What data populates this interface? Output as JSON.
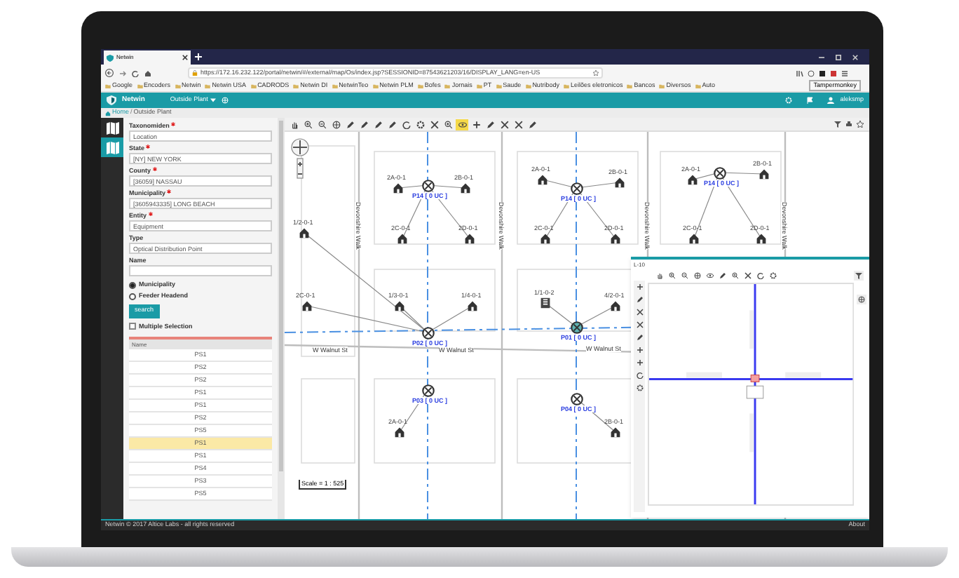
{
  "browser": {
    "tab_title": "Netwin",
    "url": "https://172.16.232.122/portal/netwin/#/external/map/Os/index.jsp?SESSIONID=87543621203/16/DISPLAY_LANG=en-US",
    "tooltip": "Tampermonkey",
    "bookmarks": [
      "Google",
      "Encoders",
      "Netwin",
      "Netwin USA",
      "CADRODS",
      "Netwin DI",
      "NetwinTeo",
      "Netwin PLM",
      "Bofes",
      "Jornais",
      "PT",
      "Saude",
      "Nutribody",
      "Leilões eletronicos",
      "Bancos",
      "Diversos",
      "Auto"
    ]
  },
  "app": {
    "brand": "Netwin",
    "module": "Outside Plant",
    "user": "aleksmp",
    "breadcrumb": [
      "Home",
      "/",
      "Outside Plant"
    ]
  },
  "rail": [
    {
      "selected": false
    },
    {
      "selected": true
    }
  ],
  "form": {
    "fields": [
      {
        "label": "Taxonomiden",
        "required": true,
        "value": "Location"
      },
      {
        "label": "State",
        "required": true,
        "value": "[NY] NEW YORK"
      },
      {
        "label": "County",
        "required": true,
        "value": "[36059] NASSAU"
      },
      {
        "label": "Municipality",
        "required": true,
        "value": "[3605943335] LONG BEACH"
      },
      {
        "label": "Entity",
        "required": true,
        "value": "Equipment"
      },
      {
        "label": "Type",
        "required": false,
        "value": "Optical Distribution Point"
      },
      {
        "label": "Name",
        "required": false
      }
    ],
    "radios": [
      {
        "label": "Municipality",
        "selected": true
      },
      {
        "label": "Feeder Headend",
        "selected": false
      }
    ],
    "search_button": "search",
    "multiple_selection": {
      "label": "Multiple Selection",
      "checked": false
    }
  },
  "results": {
    "column": "Name",
    "rows": [
      {
        "name": "PS1",
        "selected": false
      },
      {
        "name": "PS2",
        "selected": false
      },
      {
        "name": "PS2",
        "selected": false
      },
      {
        "name": "PS1",
        "selected": false
      },
      {
        "name": "PS1",
        "selected": false
      },
      {
        "name": "PS2",
        "selected": false
      },
      {
        "name": "PS5",
        "selected": false
      },
      {
        "name": "PS1",
        "selected": true
      },
      {
        "name": "PS1",
        "selected": false
      },
      {
        "name": "PS4",
        "selected": false
      },
      {
        "name": "PS3",
        "selected": false
      },
      {
        "name": "PS5",
        "selected": false
      }
    ]
  },
  "map": {
    "tools": [
      {
        "kind": "hand",
        "selected": false
      },
      {
        "kind": "zoomin",
        "selected": false
      },
      {
        "kind": "zoomout",
        "selected": false
      },
      {
        "kind": "globe",
        "selected": false
      },
      {
        "kind": "pencil",
        "selected": false
      },
      {
        "kind": "pencil",
        "selected": false
      },
      {
        "kind": "pencil",
        "selected": false
      },
      {
        "kind": "pencil",
        "selected": false
      },
      {
        "kind": "refresh",
        "selected": false
      },
      {
        "kind": "gear",
        "selected": false
      },
      {
        "kind": "cross",
        "selected": false
      },
      {
        "kind": "zoomin",
        "selected": false
      },
      {
        "kind": "eye",
        "selected": true
      },
      {
        "kind": "plus",
        "selected": false
      },
      {
        "kind": "pencil",
        "selected": false
      },
      {
        "kind": "cross",
        "selected": false
      },
      {
        "kind": "cross",
        "selected": false
      },
      {
        "kind": "pencil",
        "selected": false
      }
    ],
    "streets": [
      "Devonshire Walk",
      "Devonshire Walk",
      "Devonshire Walk",
      "Devonshire Walk",
      "W Walnut St",
      "W Walnut St",
      "W Walnut St"
    ],
    "nodes": [
      {
        "label": "P14 [ 0 UC ]"
      },
      {
        "label": "P14 [ 0 UC ]"
      },
      {
        "label": "P14 [ 0 UC ]"
      },
      {
        "label": "P02 [ 0 UC ]"
      },
      {
        "label": "P01 [ 0 UC ]"
      },
      {
        "label": "P03 [ 0 UC ]"
      },
      {
        "label": "P04 [ 0 UC ]"
      }
    ],
    "houses": [
      {
        "label": "2A-0-1",
        "kind": "house"
      },
      {
        "label": "2B-0-1",
        "kind": "house"
      },
      {
        "label": "2C-0-1",
        "kind": "house"
      },
      {
        "label": "2D-0-1",
        "kind": "house"
      },
      {
        "label": "1/3-0-1",
        "kind": "house"
      },
      {
        "label": "1/4-0-1",
        "kind": "house"
      },
      {
        "label": "2A-0-1",
        "kind": "house"
      },
      {
        "label": "2B-0-1",
        "kind": "house"
      },
      {
        "label": "2C-0-1",
        "kind": "house"
      },
      {
        "label": "2D-0-1",
        "kind": "house"
      },
      {
        "label": "1/1-0-2",
        "kind": "building"
      },
      {
        "label": "4/2-0-1",
        "kind": "house"
      },
      {
        "label": "2A-0-1",
        "kind": "house"
      },
      {
        "label": "2B-0-1",
        "kind": "house"
      },
      {
        "label": "2C-0-1",
        "kind": "house"
      },
      {
        "label": "2D-0-1",
        "kind": "house"
      },
      {
        "label": "1/2-0-1",
        "kind": "house"
      },
      {
        "label": "2C-0-1",
        "kind": "house"
      },
      {
        "label": "2A-0-1",
        "kind": "house"
      },
      {
        "label": "2B-0-1",
        "kind": "house"
      }
    ],
    "scale": "Scale = 1 : 525",
    "detail_window": {
      "title": "L-10"
    }
  },
  "footer": {
    "copyright": "Netwin © 2017 Altice Labs - all rights reserved",
    "about": "About"
  }
}
